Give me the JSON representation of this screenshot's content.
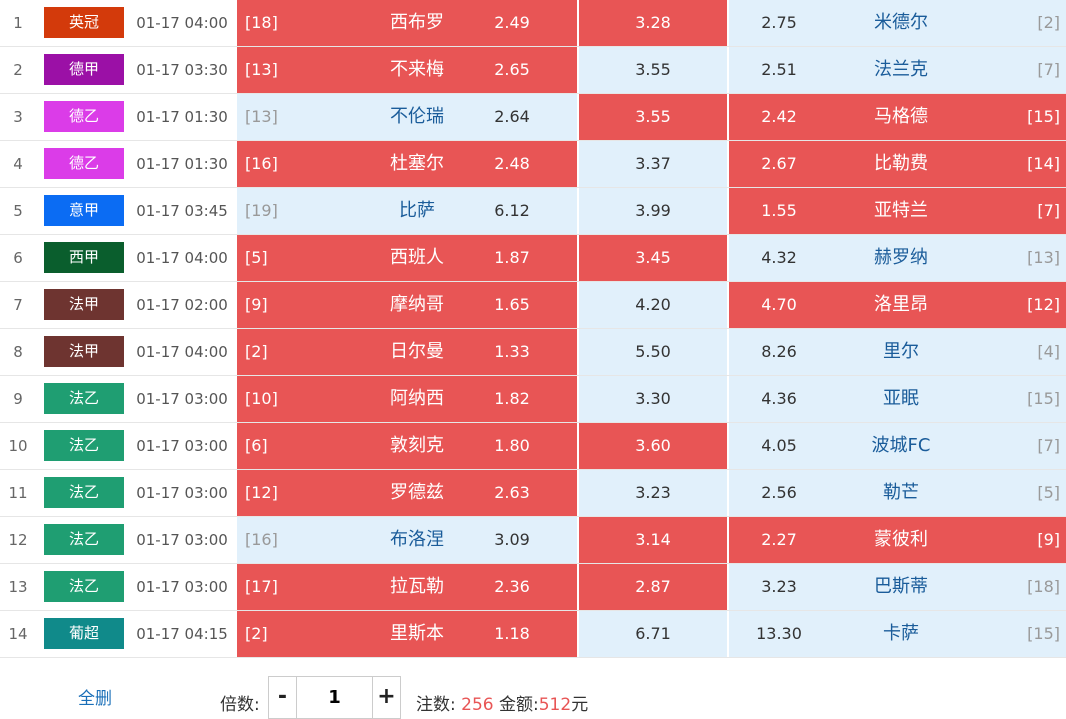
{
  "colors": {
    "selected_red": "#e85555",
    "unselected_blue": "#e1f0fb",
    "link_blue": "#1a6fb8"
  },
  "matches": [
    {
      "num": "1",
      "league": "英冠",
      "league_color": "#d33a0b",
      "time": "01-17 04:00",
      "home_rank": "[18]",
      "home": "西布罗",
      "home_odds": "2.49",
      "draw_odds": "3.28",
      "away_odds": "2.75",
      "away": "米德尔",
      "away_rank": "[2]",
      "sel": [
        1,
        1,
        0
      ]
    },
    {
      "num": "2",
      "league": "德甲",
      "league_color": "#9b10a6",
      "time": "01-17 03:30",
      "home_rank": "[13]",
      "home": "不来梅",
      "home_odds": "2.65",
      "draw_odds": "3.55",
      "away_odds": "2.51",
      "away": "法兰克",
      "away_rank": "[7]",
      "sel": [
        1,
        0,
        0
      ]
    },
    {
      "num": "3",
      "league": "德乙",
      "league_color": "#db3ce8",
      "time": "01-17 01:30",
      "home_rank": "[13]",
      "home": "不伦瑞",
      "home_odds": "2.64",
      "draw_odds": "3.55",
      "away_odds": "2.42",
      "away": "马格德",
      "away_rank": "[15]",
      "sel": [
        0,
        1,
        1
      ]
    },
    {
      "num": "4",
      "league": "德乙",
      "league_color": "#db3ce8",
      "time": "01-17 01:30",
      "home_rank": "[16]",
      "home": "杜塞尔",
      "home_odds": "2.48",
      "draw_odds": "3.37",
      "away_odds": "2.67",
      "away": "比勒费",
      "away_rank": "[14]",
      "sel": [
        1,
        0,
        1
      ]
    },
    {
      "num": "5",
      "league": "意甲",
      "league_color": "#0b6cf3",
      "time": "01-17 03:45",
      "home_rank": "[19]",
      "home": "比萨",
      "home_odds": "6.12",
      "draw_odds": "3.99",
      "away_odds": "1.55",
      "away": "亚特兰",
      "away_rank": "[7]",
      "sel": [
        0,
        0,
        1
      ]
    },
    {
      "num": "6",
      "league": "西甲",
      "league_color": "#0a5e2d",
      "time": "01-17 04:00",
      "home_rank": "[5]",
      "home": "西班人",
      "home_odds": "1.87",
      "draw_odds": "3.45",
      "away_odds": "4.32",
      "away": "赫罗纳",
      "away_rank": "[13]",
      "sel": [
        1,
        1,
        0
      ]
    },
    {
      "num": "7",
      "league": "法甲",
      "league_color": "#6e3430",
      "time": "01-17 02:00",
      "home_rank": "[9]",
      "home": "摩纳哥",
      "home_odds": "1.65",
      "draw_odds": "4.20",
      "away_odds": "4.70",
      "away": "洛里昂",
      "away_rank": "[12]",
      "sel": [
        1,
        0,
        1
      ]
    },
    {
      "num": "8",
      "league": "法甲",
      "league_color": "#6e3430",
      "time": "01-17 04:00",
      "home_rank": "[2]",
      "home": "日尔曼",
      "home_odds": "1.33",
      "draw_odds": "5.50",
      "away_odds": "8.26",
      "away": "里尔",
      "away_rank": "[4]",
      "sel": [
        1,
        0,
        0
      ]
    },
    {
      "num": "9",
      "league": "法乙",
      "league_color": "#1f9e72",
      "time": "01-17 03:00",
      "home_rank": "[10]",
      "home": "阿纳西",
      "home_odds": "1.82",
      "draw_odds": "3.30",
      "away_odds": "4.36",
      "away": "亚眠",
      "away_rank": "[15]",
      "sel": [
        1,
        0,
        0
      ]
    },
    {
      "num": "10",
      "league": "法乙",
      "league_color": "#1f9e72",
      "time": "01-17 03:00",
      "home_rank": "[6]",
      "home": "敦刻克",
      "home_odds": "1.80",
      "draw_odds": "3.60",
      "away_odds": "4.05",
      "away": "波城FC",
      "away_rank": "[7]",
      "sel": [
        1,
        1,
        0
      ]
    },
    {
      "num": "11",
      "league": "法乙",
      "league_color": "#1f9e72",
      "time": "01-17 03:00",
      "home_rank": "[12]",
      "home": "罗德兹",
      "home_odds": "2.63",
      "draw_odds": "3.23",
      "away_odds": "2.56",
      "away": "勒芒",
      "away_rank": "[5]",
      "sel": [
        1,
        0,
        0
      ]
    },
    {
      "num": "12",
      "league": "法乙",
      "league_color": "#1f9e72",
      "time": "01-17 03:00",
      "home_rank": "[16]",
      "home": "布洛涅",
      "home_odds": "3.09",
      "draw_odds": "3.14",
      "away_odds": "2.27",
      "away": "蒙彼利",
      "away_rank": "[9]",
      "sel": [
        0,
        1,
        1
      ]
    },
    {
      "num": "13",
      "league": "法乙",
      "league_color": "#1f9e72",
      "time": "01-17 03:00",
      "home_rank": "[17]",
      "home": "拉瓦勒",
      "home_odds": "2.36",
      "draw_odds": "2.87",
      "away_odds": "3.23",
      "away": "巴斯蒂",
      "away_rank": "[18]",
      "sel": [
        1,
        1,
        0
      ]
    },
    {
      "num": "14",
      "league": "葡超",
      "league_color": "#108a8a",
      "time": "01-17 04:15",
      "home_rank": "[2]",
      "home": "里斯本",
      "home_odds": "1.18",
      "draw_odds": "6.71",
      "away_odds": "13.30",
      "away": "卡萨",
      "away_rank": "[15]",
      "sel": [
        1,
        0,
        0
      ]
    }
  ],
  "footer": {
    "clear_label": "全删",
    "multiplier_label": "倍数:",
    "minus": "-",
    "plus": "+",
    "multiplier_value": "1",
    "bets_label": "注数:",
    "bets_value": "256",
    "amount_label": "金额:",
    "amount_value": "512",
    "currency": "元"
  }
}
